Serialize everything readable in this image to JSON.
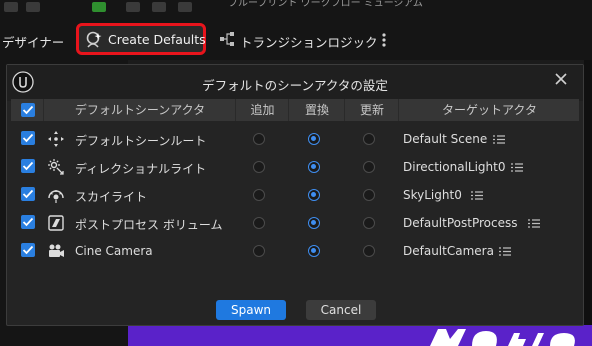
{
  "toolbar": {
    "top_cut_text": "ブループリント   ワークフロー   ミュージアム",
    "designer_tab": "デザイナー",
    "create_defaults": "Create Defaults",
    "transition_logic": "トランジションロジック"
  },
  "dialog": {
    "title": "デフォルトのシーンアクタの設定",
    "columns": {
      "actor": "デフォルトシーンアクタ",
      "add": "追加",
      "replace": "置換",
      "update": "更新",
      "target": "ターゲットアクタ"
    },
    "rows": [
      {
        "name": "デフォルトシーンルート",
        "icon": "scene-root-icon",
        "checked": true,
        "selected": "replace",
        "target": "Default Scene"
      },
      {
        "name": "ディレクショナルライト",
        "icon": "directional-light-icon",
        "checked": true,
        "selected": "replace",
        "target": "DirectionalLight0"
      },
      {
        "name": "スカイライト",
        "icon": "skylight-icon",
        "checked": true,
        "selected": "replace",
        "target": "SkyLight0"
      },
      {
        "name": "ポストプロセス ボリューム",
        "icon": "post-process-icon",
        "checked": true,
        "selected": "replace",
        "target": "DefaultPostProcess"
      },
      {
        "name": "Cine Camera",
        "icon": "cine-camera-icon",
        "checked": true,
        "selected": "replace",
        "target": "DefaultCamera"
      }
    ],
    "spawn_label": "Spawn",
    "cancel_label": "Cancel"
  },
  "colors": {
    "highlight": "#e8141c",
    "accent": "#2a7fe0",
    "background_purple": "#5a22c9"
  }
}
